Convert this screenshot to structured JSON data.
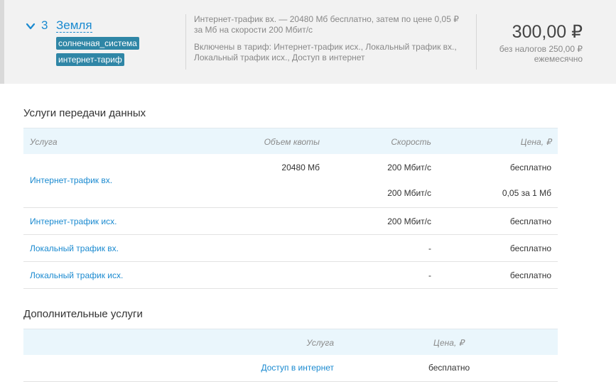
{
  "tariff": {
    "number": "3",
    "name": "Земля",
    "tags": [
      "солнечная_система",
      "интернет-тариф"
    ],
    "description_line1": "Интернет-трафик вх. — 20480 Мб бесплатно, затем по цене 0,05 ₽ за Мб на скорости 200 Мбит/с",
    "description_line2": "Включены в тариф: Интернет-трафик исх., Локальный трафик вх., Локальный трафик исх., Доступ в интернет",
    "price": "300,00 ₽",
    "price_no_tax": "без налогов 250,00 ₽",
    "period": "ежемесячно"
  },
  "data_services": {
    "title": "Услуги передачи данных",
    "headers": {
      "service": "Услуга",
      "quota": "Объем квоты",
      "speed": "Скорость",
      "price": "Цена, ₽"
    },
    "rows": [
      {
        "service": "Интернет-трафик вх.",
        "lines": [
          {
            "quota": "20480 Мб",
            "speed": "200 Мбит/с",
            "price": "бесплатно"
          },
          {
            "quota": "",
            "speed": "200 Мбит/с",
            "price": "0,05 за 1 Мб"
          }
        ]
      },
      {
        "service": "Интернет-трафик исх.",
        "quota": "",
        "speed": "200 Мбит/с",
        "price": "бесплатно"
      },
      {
        "service": "Локальный трафик вх.",
        "quota": "",
        "speed": "-",
        "price": "бесплатно"
      },
      {
        "service": "Локальный трафик исх.",
        "quota": "",
        "speed": "-",
        "price": "бесплатно"
      }
    ]
  },
  "extra_services": {
    "title": "Дополнительные услуги",
    "headers": {
      "service": "Услуга",
      "price": "Цена, ₽"
    },
    "rows": [
      {
        "service": "Доступ в интернет",
        "price": "бесплатно"
      }
    ]
  },
  "colors": {
    "link": "#1a8ad0",
    "tag_bg": "#2f86a6",
    "table_header_bg": "#eaf6fc",
    "header_bg": "#f2f2f2"
  },
  "icons": {
    "expand": "chevron-down-icon"
  }
}
